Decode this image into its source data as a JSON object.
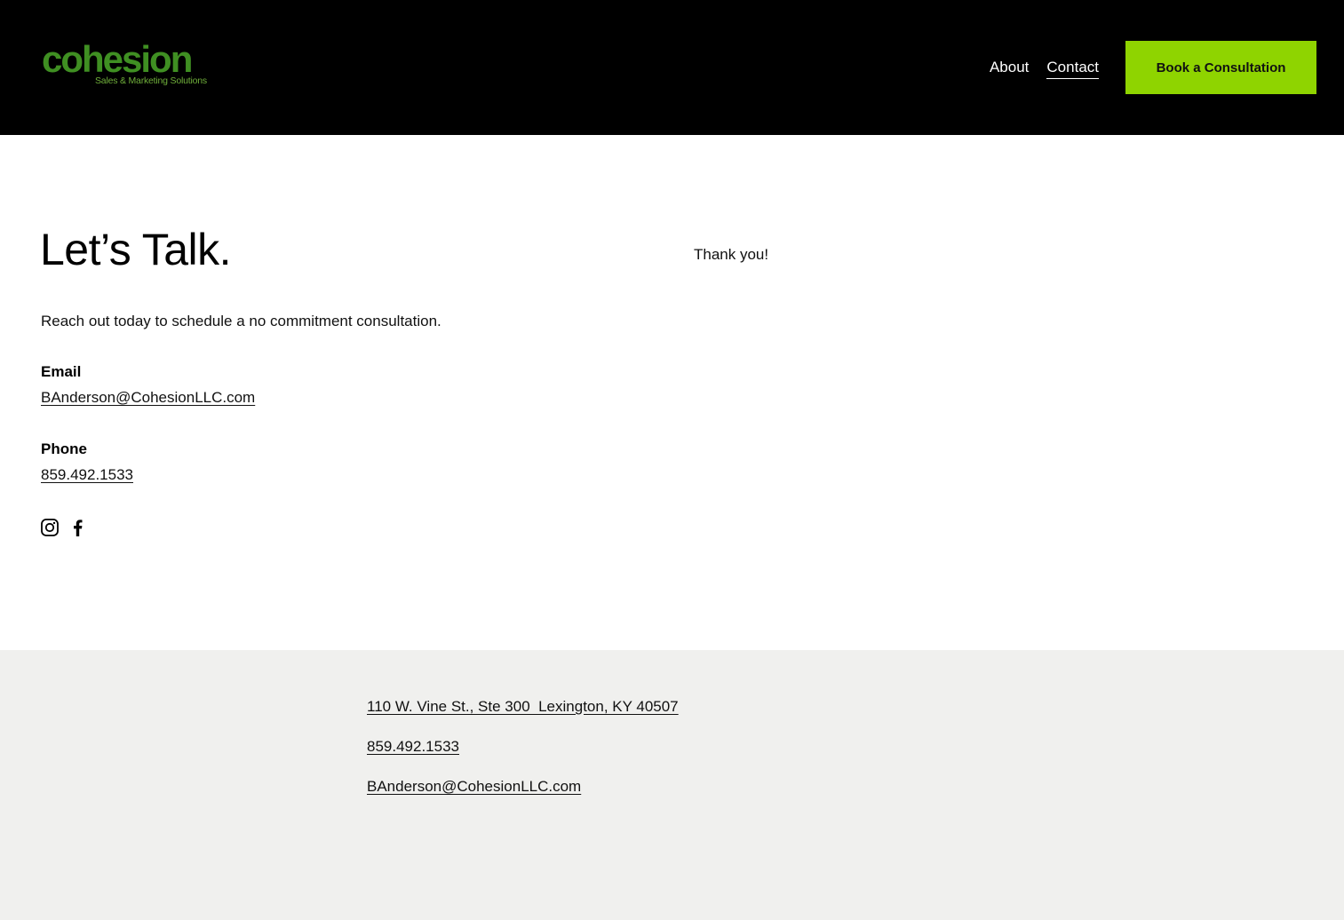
{
  "header": {
    "logo_text": "cohesion",
    "logo_tagline": "Sales & Marketing Solutions",
    "nav": [
      {
        "label": "About",
        "active": false
      },
      {
        "label": "Contact",
        "active": true
      }
    ],
    "cta_label": "Book a Consultation"
  },
  "main": {
    "title": "Let’s Talk.",
    "intro": "Reach out today to schedule a no commitment consultation.",
    "email_label": "Email",
    "email": "BAnderson@CohesionLLC.com",
    "phone_label": "Phone",
    "phone": "859.492.1533",
    "social_icons": [
      "instagram-icon",
      "facebook-icon"
    ],
    "thank_you": "Thank you!"
  },
  "footer": {
    "address": "110 W. Vine St., Ste 300  Lexington, KY 40507",
    "phone": "859.492.1533",
    "email": "BAnderson@CohesionLLC.com"
  },
  "colors": {
    "header_bg": "#000000",
    "accent": "#8fd400",
    "logo_green": "#3f8f22",
    "footer_bg": "#f0f0ee"
  }
}
